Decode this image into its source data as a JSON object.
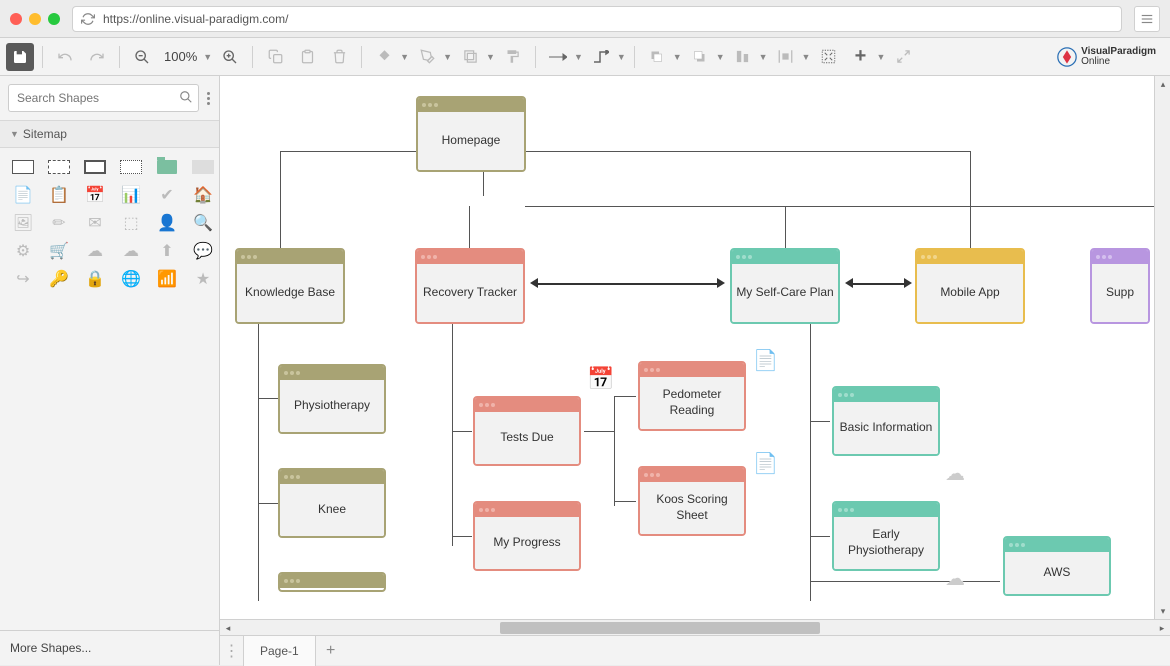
{
  "browser": {
    "url": "https://online.visual-paradigm.com/"
  },
  "toolbar": {
    "zoom": "100%"
  },
  "sidebar": {
    "search_placeholder": "Search Shapes",
    "category": "Sitemap",
    "more_shapes": "More Shapes..."
  },
  "logo": {
    "line1": "VisualParadigm",
    "line2": "Online"
  },
  "tabs": {
    "page1": "Page-1"
  },
  "diagram": {
    "homepage": "Homepage",
    "knowledge_base": "Knowledge Base",
    "recovery_tracker": "Recovery Tracker",
    "self_care": "My Self-Care Plan",
    "mobile_app": "Mobile App",
    "support": "Supp",
    "physiotherapy": "Physiotherapy",
    "knee": "Knee",
    "tests_due": "Tests Due",
    "my_progress": "My Progress",
    "pedometer": "Pedometer Reading",
    "koos": "Koos Scoring Sheet",
    "basic_info": "Basic Information",
    "early_physio": "Early Physiotherapy",
    "aws": "AWS"
  },
  "chart_data": {
    "type": "tree",
    "root": {
      "label": "Homepage",
      "color": "olive",
      "children": [
        {
          "label": "Knowledge Base",
          "color": "olive",
          "children": [
            {
              "label": "Physiotherapy",
              "color": "olive"
            },
            {
              "label": "Knee",
              "color": "olive"
            }
          ]
        },
        {
          "label": "Recovery Tracker",
          "color": "salmon",
          "children": [
            {
              "label": "Tests Due",
              "color": "salmon",
              "children": [
                {
                  "label": "Pedometer Reading",
                  "color": "salmon"
                },
                {
                  "label": "Koos Scoring Sheet",
                  "color": "salmon"
                }
              ]
            },
            {
              "label": "My Progress",
              "color": "salmon"
            }
          ]
        },
        {
          "label": "My Self-Care Plan",
          "color": "teal",
          "children": [
            {
              "label": "Basic Information",
              "color": "teal"
            },
            {
              "label": "Early Physiotherapy",
              "color": "teal"
            },
            {
              "label": "AWS",
              "color": "teal"
            }
          ]
        },
        {
          "label": "Mobile App",
          "color": "yellow"
        },
        {
          "label": "Support",
          "color": "purple"
        }
      ]
    },
    "cross_links": [
      {
        "from": "Recovery Tracker",
        "to": "My Self-Care Plan",
        "bidirectional": true
      },
      {
        "from": "My Self-Care Plan",
        "to": "Mobile App",
        "bidirectional": true
      }
    ]
  }
}
